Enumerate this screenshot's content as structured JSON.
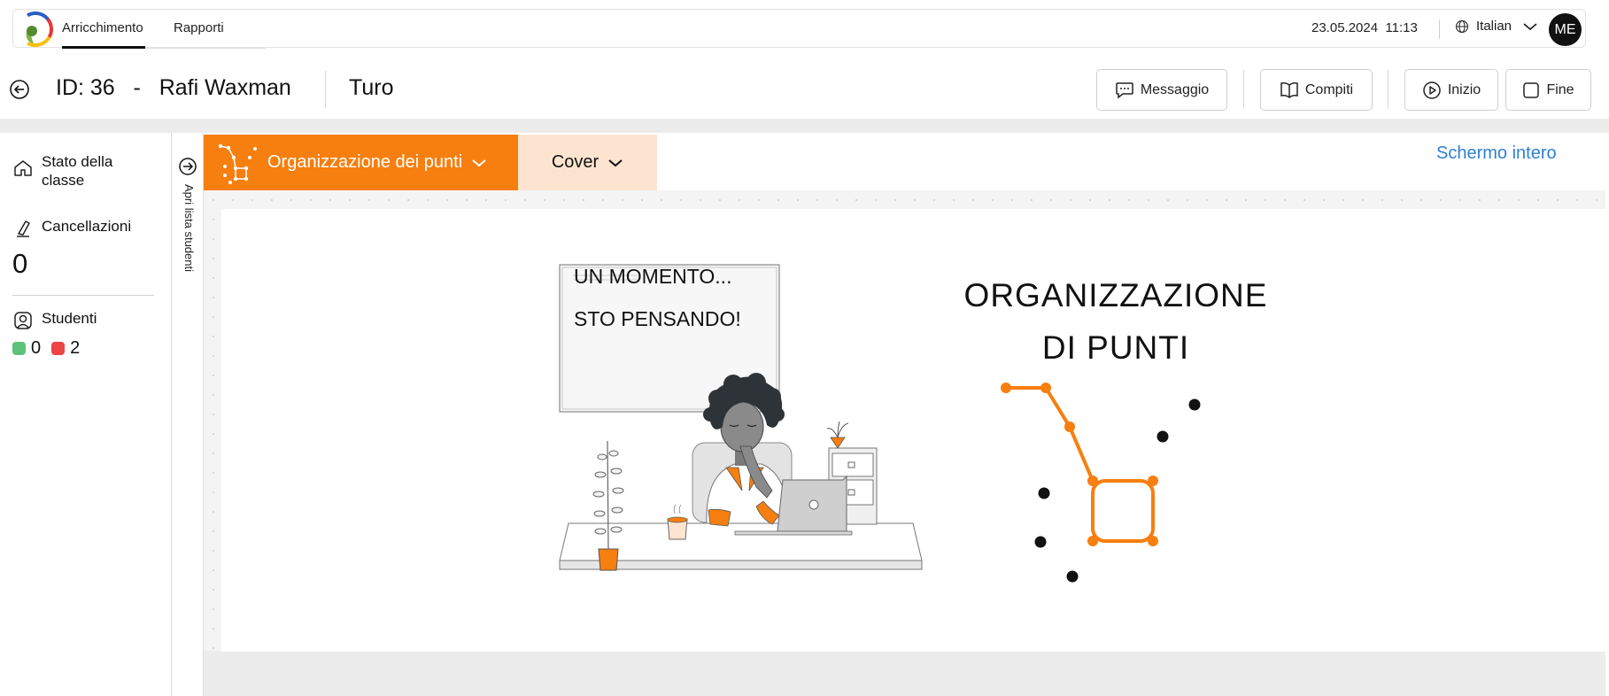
{
  "nav": {
    "tabs": [
      {
        "label": "Arricchimento",
        "active": true
      },
      {
        "label": "Rapporti",
        "active": false
      }
    ],
    "date": "23.05.2024",
    "time": "11:13",
    "language": "Italian",
    "avatar_initials": "ME"
  },
  "header": {
    "id_label": "ID: 36",
    "separator": "-",
    "student_name": "Rafi Waxman",
    "session_type": "Turo",
    "buttons": {
      "message": "Messaggio",
      "tasks": "Compiti",
      "start": "Inizio",
      "end": "Fine"
    }
  },
  "sidebar": {
    "class_status": "Stato della classe",
    "cancellations_label": "Cancellazioni",
    "cancellations_count": "0",
    "students_label": "Studenti",
    "students_online": "0",
    "students_offline": "2",
    "colors": {
      "online": "#5cc27a",
      "offline": "#ef4444"
    }
  },
  "drawer": {
    "label": "Apri lista studenti"
  },
  "activity": {
    "current_tab": "Organizzazione dei punti",
    "section_tab": "Cover",
    "fullscreen_label": "Schermo intero",
    "accent_color": "#f77f0f"
  },
  "slide": {
    "title_line1": "ORGANIZZAZIONE",
    "title_line2": "DI PUNTI",
    "thought_line1": "UN MOMENTO...",
    "thought_line2": "STO PENSANDO!"
  }
}
